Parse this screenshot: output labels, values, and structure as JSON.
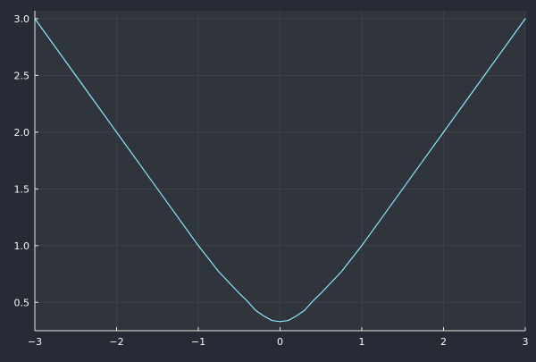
{
  "colors": {
    "figure_background": "#282a36",
    "plot_background": "#30343b",
    "grid": "#4a4f58",
    "axis": "#e8e8e8",
    "tick_text": "#f8f8f2",
    "series": "#8be9fd"
  },
  "chart_data": {
    "type": "line",
    "title": "",
    "xlabel": "",
    "ylabel": "",
    "xlim": [
      -3,
      3
    ],
    "ylim": [
      0.25,
      3.07
    ],
    "x_ticks": [
      -3,
      -2,
      -1,
      0,
      1,
      2,
      3
    ],
    "x_tick_labels": [
      "−3",
      "−2",
      "−1",
      "0",
      "1",
      "2",
      "3"
    ],
    "y_ticks": [
      0.5,
      1.0,
      1.5,
      2.0,
      2.5,
      3.0
    ],
    "y_tick_labels": [
      "0.5",
      "1.0",
      "1.5",
      "2.0",
      "2.5",
      "3.0"
    ],
    "grid": true,
    "legend": "none",
    "series": [
      {
        "x": [
          -3,
          -2.75,
          -2.5,
          -2.25,
          -2,
          -1.75,
          -1.5,
          -1.25,
          -1,
          -0.75,
          -0.5,
          -0.4,
          -0.3,
          -0.2,
          -0.1,
          0,
          0.1,
          0.2,
          0.3,
          0.4,
          0.5,
          0.75,
          1,
          1.25,
          1.5,
          1.75,
          2,
          2.25,
          2.5,
          2.75,
          3
        ],
        "y": [
          3.0,
          2.75,
          2.5,
          2.25,
          2.0,
          1.75,
          1.5,
          1.25,
          1.0,
          0.77,
          0.58,
          0.51,
          0.43,
          0.38,
          0.34,
          0.33,
          0.34,
          0.38,
          0.43,
          0.51,
          0.58,
          0.77,
          1.0,
          1.25,
          1.5,
          1.75,
          2.0,
          2.25,
          2.5,
          2.75,
          3.0
        ]
      }
    ]
  }
}
